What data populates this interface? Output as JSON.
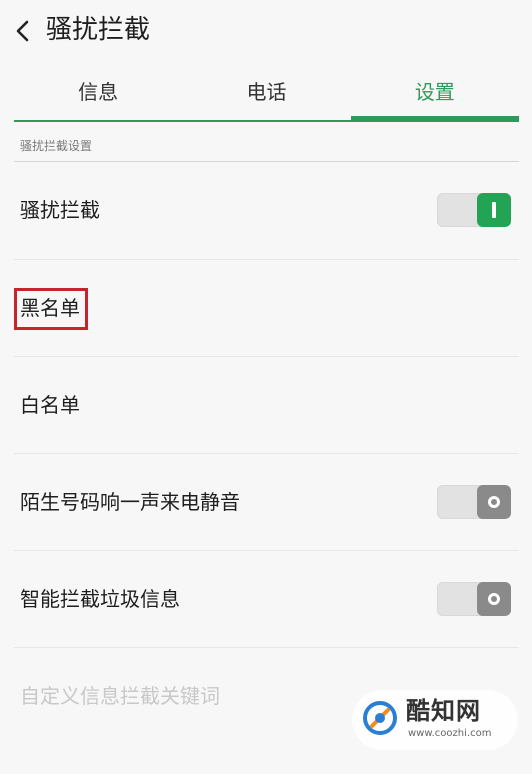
{
  "header": {
    "title": "骚扰拦截",
    "back_icon": "chevron-left-icon"
  },
  "tabs": [
    {
      "label": "信息",
      "active": false
    },
    {
      "label": "电话",
      "active": false
    },
    {
      "label": "设置",
      "active": true
    }
  ],
  "section": {
    "title": "骚扰拦截设置"
  },
  "rows": [
    {
      "label": "骚扰拦截",
      "toggle": "on"
    },
    {
      "label": "黑名单"
    },
    {
      "label": "白名单"
    },
    {
      "label": "陌生号码响一声来电静音",
      "toggle": "off"
    },
    {
      "label": "智能拦截垃圾信息",
      "toggle": "off"
    },
    {
      "label": "自定义信息拦截关键词",
      "disabled": true
    }
  ],
  "watermark": {
    "text": "酷知网",
    "url": "www.coozhi.com"
  },
  "colors": {
    "accent": "#2e9a5c",
    "toggle_on": "#23a455",
    "highlight": "#c8232c"
  }
}
